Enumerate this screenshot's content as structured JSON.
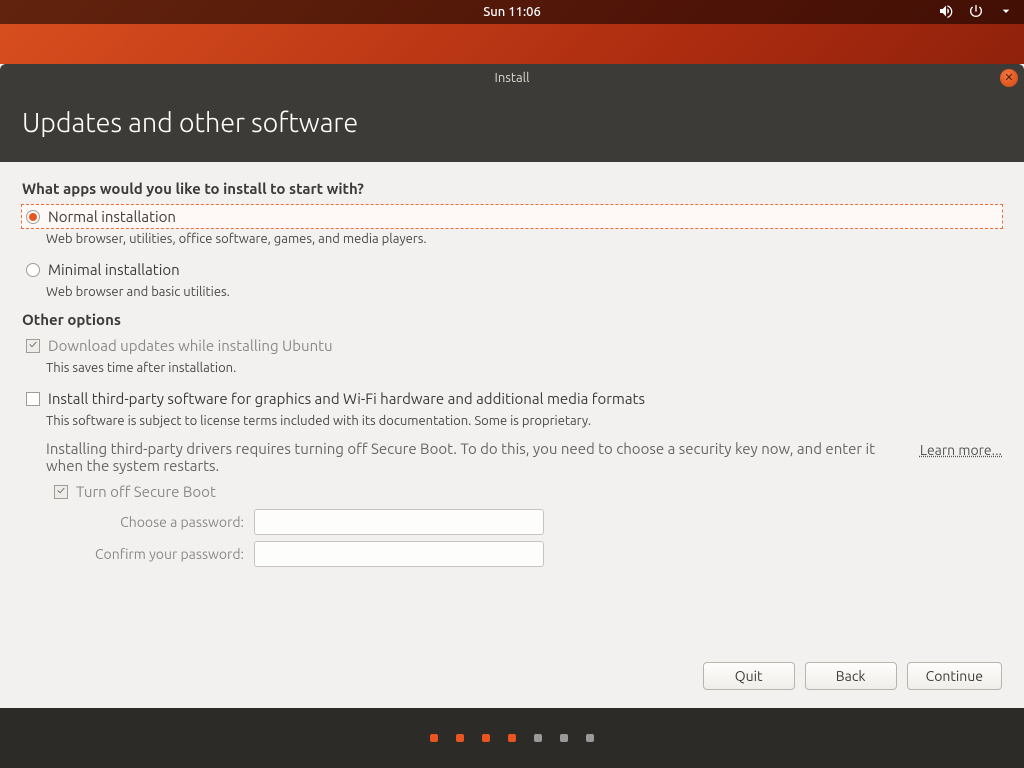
{
  "menubar": {
    "clock": "Sun 11:06"
  },
  "window": {
    "title": "Install",
    "header": "Updates and other software"
  },
  "q": {
    "apps_heading": "What apps would you like to install to start with?",
    "normal": {
      "label": "Normal installation",
      "desc": "Web browser, utilities, office software, games, and media players."
    },
    "minimal": {
      "label": "Minimal installation",
      "desc": "Web browser and basic utilities."
    }
  },
  "other": {
    "heading": "Other options",
    "download": {
      "label": "Download updates while installing Ubuntu",
      "desc": "This saves time after installation."
    },
    "thirdparty": {
      "label": "Install third-party software for graphics and Wi-Fi hardware and additional media formats",
      "desc": "This software is subject to license terms included with its documentation. Some is proprietary."
    },
    "secureboot_note": "Installing third-party drivers requires turning off Secure Boot. To do this, you need to choose a security key now, and enter it when the system restarts.",
    "learn_more": "Learn more...",
    "turnoff_label": "Turn off Secure Boot",
    "choose_pw_label": "Choose a password:",
    "confirm_pw_label": "Confirm your password:"
  },
  "buttons": {
    "quit": "Quit",
    "back": "Back",
    "continue": "Continue"
  },
  "progress": {
    "total": 7,
    "current": 4
  }
}
